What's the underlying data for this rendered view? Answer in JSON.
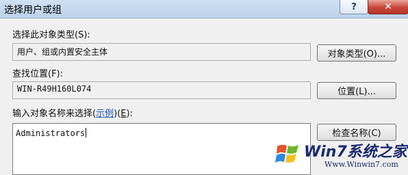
{
  "window": {
    "title": "选择用户或组",
    "help_label": "?",
    "close_label": "✕"
  },
  "object_types": {
    "label": "选择此对象类型(S):",
    "value": "用户、组或内置安全主体",
    "button_label": "对象类型(O)..."
  },
  "location": {
    "label": "查找位置(F):",
    "value": "WIN-R49H160L074",
    "button_label": "位置(L)..."
  },
  "names": {
    "label_prefix": "输入对象名称来选择(",
    "label_link": "示例",
    "label_suffix": ")(",
    "label_key": "E",
    "label_end": "):",
    "value": "Administrators",
    "check_button_label": "检查名称(C)"
  },
  "watermark": {
    "logo_icon": "windows-logo-icon",
    "text": "Win7系统之家",
    "url": "Www.Winwin7.com"
  }
}
